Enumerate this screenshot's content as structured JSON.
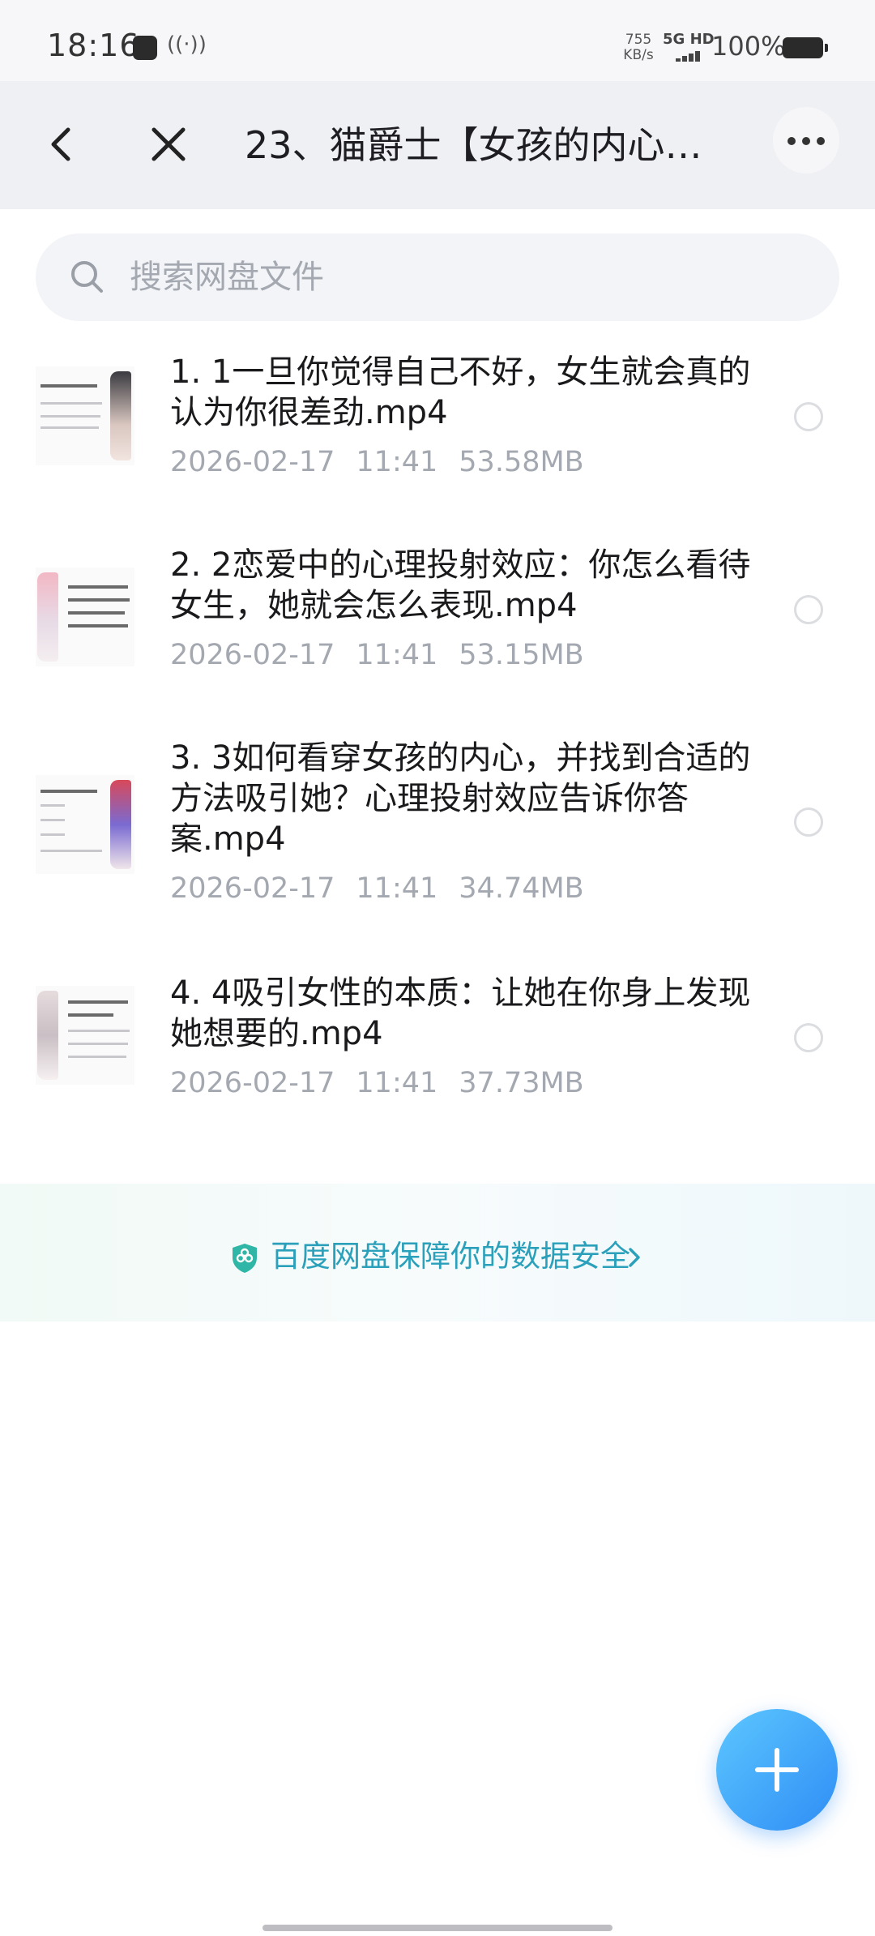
{
  "status_bar": {
    "time": "18:16",
    "net_speed_value": "755",
    "net_speed_unit": "KB/s",
    "network": "5G HD",
    "battery": "100%"
  },
  "nav": {
    "title": "23、猫爵士【女孩的内心…"
  },
  "search": {
    "placeholder": "搜索网盘文件"
  },
  "files": [
    {
      "name": "1. 1一旦你觉得自己不好，女生就会真的认为你很差劲.mp4",
      "date": "2026-02-17",
      "time": "11:41",
      "size": "53.58MB"
    },
    {
      "name": "2. 2恋爱中的心理投射效应：你怎么看待女生，她就会怎么表现.mp4",
      "date": "2026-02-17",
      "time": "11:41",
      "size": "53.15MB"
    },
    {
      "name": "3. 3如何看穿女孩的内心，并找到合适的方法吸引她？心理投射效应告诉你答案.mp4",
      "date": "2026-02-17",
      "time": "11:41",
      "size": "34.74MB"
    },
    {
      "name": "4. 4吸引女性的本质：让她在你身上发现她想要的.mp4",
      "date": "2026-02-17",
      "time": "11:41",
      "size": "37.73MB"
    }
  ],
  "security_banner": {
    "text": "百度网盘保障你的数据安全"
  },
  "colors": {
    "accent": "#2f8df5",
    "security_text": "#2aa0bb",
    "meta_text": "#a4a8b0"
  }
}
